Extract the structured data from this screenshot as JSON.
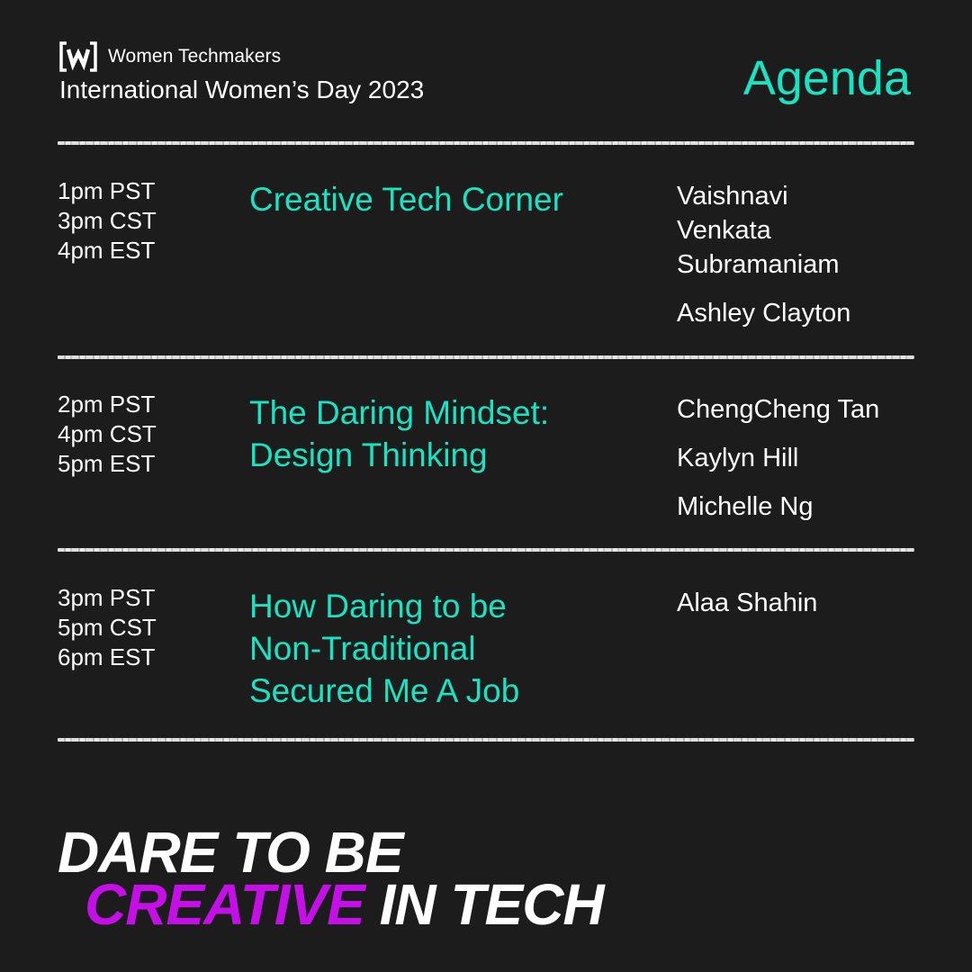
{
  "header": {
    "brand_name": "Women Techmakers",
    "event_title": "International Women’s Day 2023",
    "agenda_title": "Agenda",
    "logo_icon": "women-techmakers-logo"
  },
  "sessions": [
    {
      "times": [
        "1pm PST",
        "3pm CST",
        "4pm EST"
      ],
      "title_lines": [
        "Creative Tech Corner"
      ],
      "speakers": [
        "Vaishnavi Venkata Subramaniam",
        "Ashley Clayton"
      ]
    },
    {
      "times": [
        "2pm PST",
        "4pm CST",
        "5pm EST"
      ],
      "title_lines": [
        "The Daring Mindset:",
        "Design Thinking"
      ],
      "speakers": [
        "ChengCheng Tan",
        "Kaylyn Hill",
        "Michelle Ng"
      ]
    },
    {
      "times": [
        "3pm PST",
        "5pm CST",
        "6pm EST"
      ],
      "title_lines": [
        "How Daring to be",
        "Non-Traditional",
        "Secured Me A Job"
      ],
      "speakers": [
        "Alaa Shahin"
      ]
    }
  ],
  "tagline": {
    "line1": "DARE TO BE",
    "highlight": "CREATIVE",
    "rest": " IN TECH"
  },
  "colors": {
    "background": "#1c1c1c",
    "accent": "#19e3c1",
    "highlight": "#c40fe6",
    "text": "#ffffff"
  }
}
